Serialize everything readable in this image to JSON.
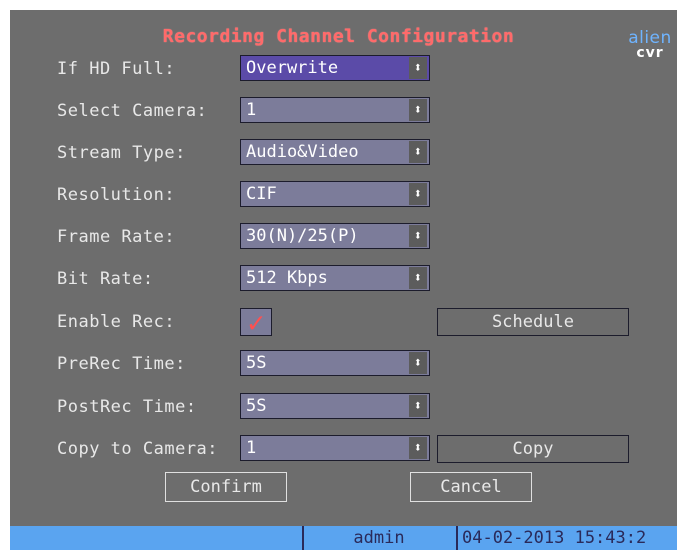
{
  "dialog": {
    "title": "Recording Channel Configuration",
    "logo_top": "alien",
    "logo_bottom": "cvr"
  },
  "fields": {
    "if_hd_full": {
      "label": "If HD Full:",
      "value": "Overwrite"
    },
    "select_camera": {
      "label": "Select Camera:",
      "value": "1"
    },
    "stream_type": {
      "label": "Stream Type:",
      "value": "Audio&Video"
    },
    "resolution": {
      "label": "Resolution:",
      "value": "CIF"
    },
    "frame_rate": {
      "label": "Frame Rate:",
      "value": "30(N)/25(P)"
    },
    "bit_rate": {
      "label": "Bit Rate:",
      "value": "512 Kbps"
    },
    "enable_rec": {
      "label": "Enable Rec:",
      "checked": true,
      "check_glyph": "✓"
    },
    "prerec_time": {
      "label": "PreRec Time:",
      "value": "5S"
    },
    "postrec_time": {
      "label": "PostRec Time:",
      "value": "5S"
    },
    "copy_to_camera": {
      "label": "Copy to Camera:",
      "value": "1"
    }
  },
  "buttons": {
    "schedule": "Schedule",
    "copy": "Copy",
    "confirm": "Confirm",
    "cancel": "Cancel"
  },
  "status_bar": {
    "user": "admin",
    "datetime": "04-02-2013 15:43:2"
  },
  "icons": {
    "dropdown": "updown-arrow-icon",
    "arrow_glyph": "⬍"
  },
  "colors": {
    "background": "#6d6d6d",
    "title": "#ff6a6a",
    "selected_field": "#5b4ba8",
    "field": "#7c7c9a",
    "status_bar": "#5aa4f0",
    "checkmark": "#ff5050"
  }
}
